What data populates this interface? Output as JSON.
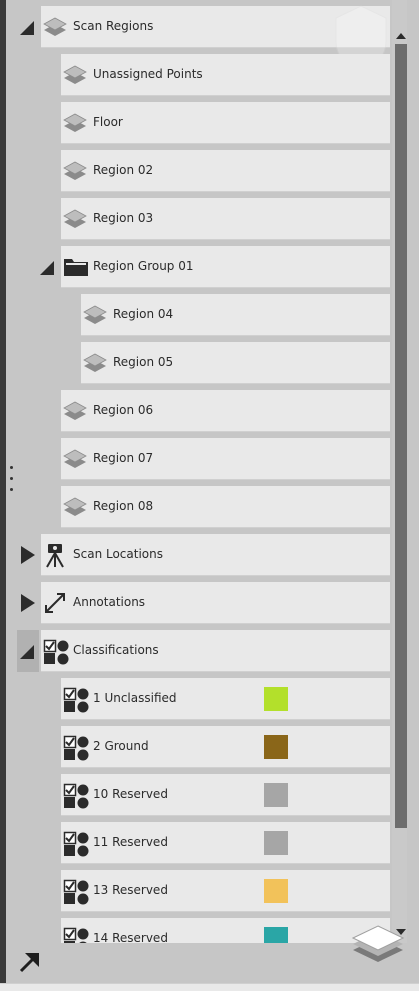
{
  "panel": {
    "icons": {
      "layers": "layers-icon",
      "folder": "folder-icon",
      "scanner": "scanner-tripod-icon",
      "measure": "measure-line-icon",
      "classification": "classification-icon",
      "expand": "expand-arrow-icon",
      "collapse": "collapse-triangle-icon",
      "disclosure": "disclosure-triangle-icon"
    },
    "colors": {
      "unclassified": "#b3e02b",
      "ground": "#8a6619",
      "reserved_10": "#a6a6a6",
      "reserved_11": "#a6a6a6",
      "reserved_13": "#f2c25a",
      "reserved_14": "#2aa6a6"
    }
  },
  "tree": {
    "scan_regions": {
      "label": "Scan Regions",
      "children": [
        {
          "label": "Unassigned Points"
        },
        {
          "label": "Floor"
        },
        {
          "label": "Region 02"
        },
        {
          "label": "Region 03"
        }
      ]
    },
    "region_group": {
      "label": "Region Group 01",
      "children": [
        {
          "label": "Region 04"
        },
        {
          "label": "Region 05"
        }
      ]
    },
    "regions_after": [
      {
        "label": "Region 06"
      },
      {
        "label": "Region 07"
      },
      {
        "label": "Region 08"
      }
    ],
    "scan_locations": {
      "label": "Scan Locations"
    },
    "annotations": {
      "label": "Annotations"
    },
    "classifications": {
      "label": "Classifications",
      "items": [
        {
          "label": "1 Unclassified",
          "color": "#b3e02b"
        },
        {
          "label": "2 Ground",
          "color": "#8a6619"
        },
        {
          "label": "10 Reserved",
          "color": "#a6a6a6"
        },
        {
          "label": "11 Reserved",
          "color": "#a6a6a6"
        },
        {
          "label": "13 Reserved",
          "color": "#f2c25a"
        },
        {
          "label": "14 Reserved",
          "color": "#2aa6a6"
        }
      ]
    }
  }
}
